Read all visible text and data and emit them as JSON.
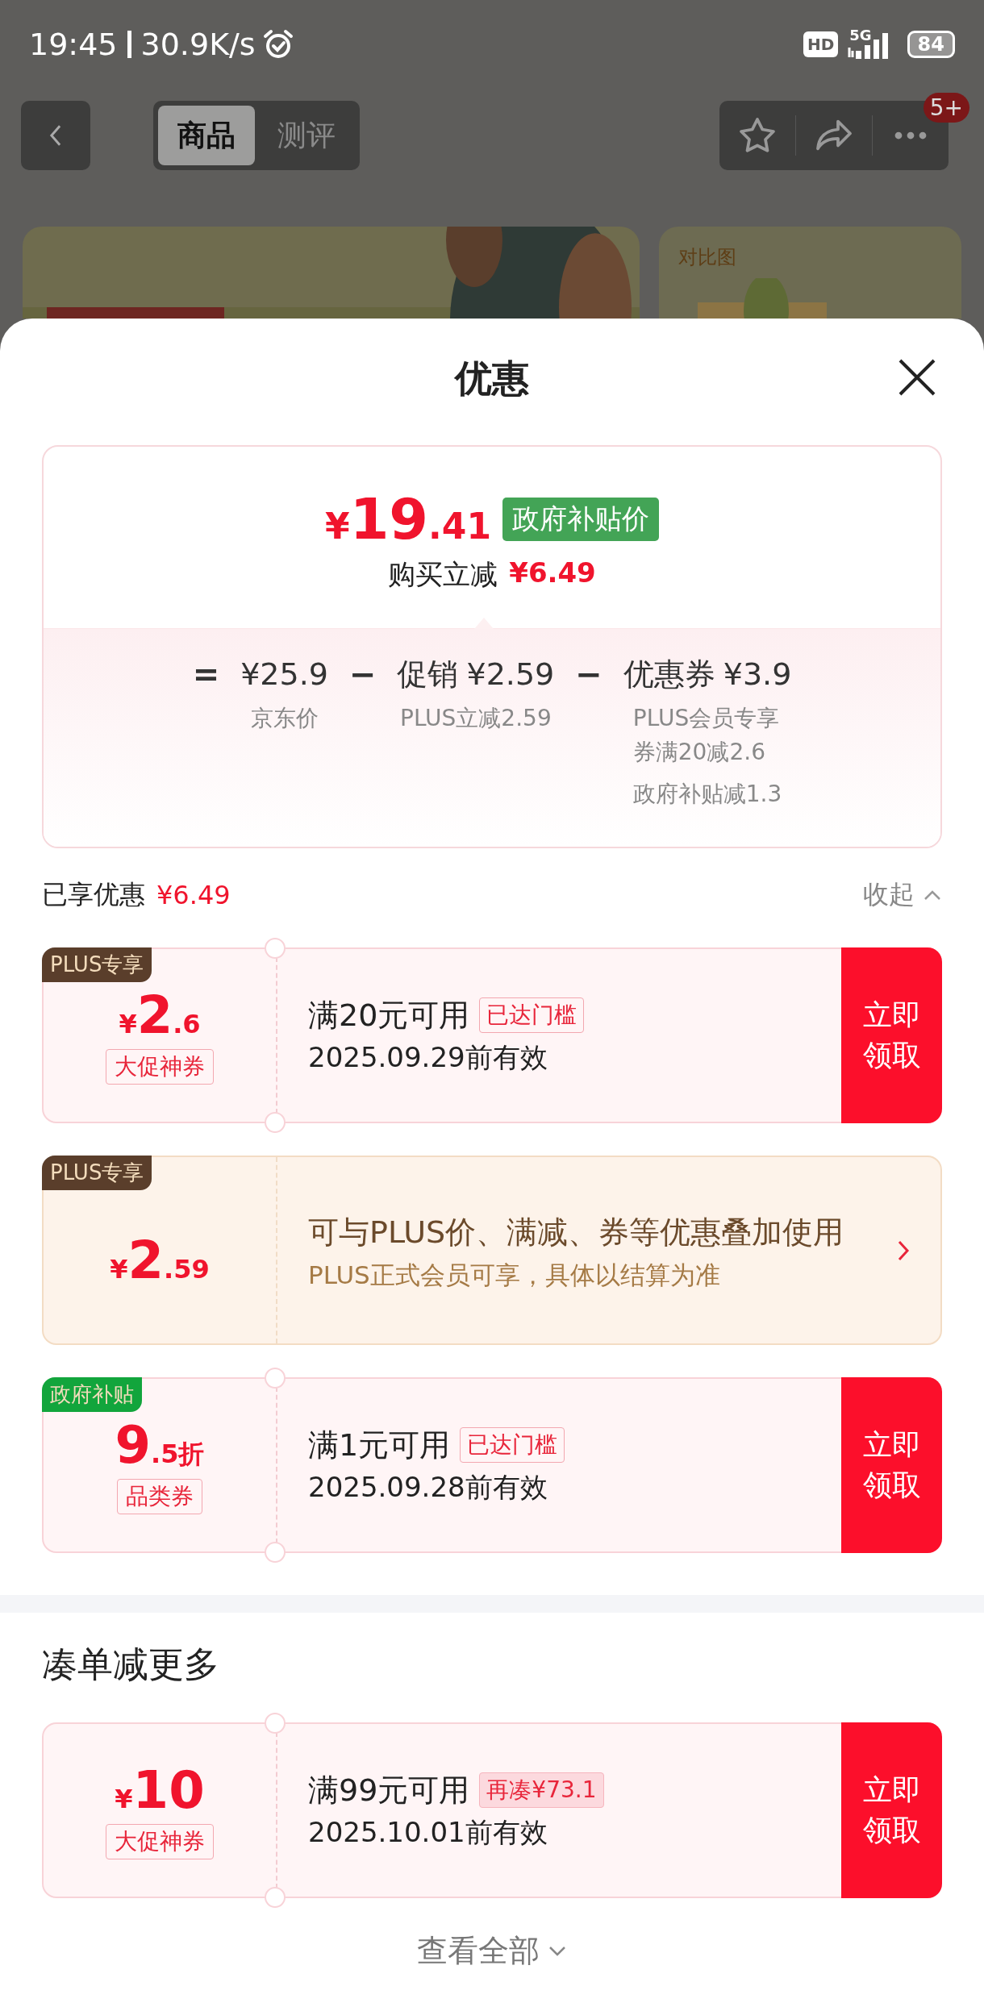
{
  "status_bar": {
    "time": "19:45",
    "speed": "30.9K/s",
    "hd": "HD",
    "network": "5G",
    "battery": "84"
  },
  "nav": {
    "tabs": [
      {
        "label": "商品",
        "selected": true
      },
      {
        "label": "测评",
        "selected": false
      }
    ],
    "badge": "5+"
  },
  "background": {
    "compare_label": "对比图"
  },
  "sheet": {
    "title": "优惠"
  },
  "summary": {
    "price": {
      "symbol": "¥",
      "integer": "19",
      "decimal": ".41"
    },
    "tag": "政府补贴价",
    "reduction_label": "购买立减",
    "reduction": "¥6.49",
    "breakdown": [
      {
        "operator": "=",
        "amount": "¥25.9",
        "notes": [
          "京东价"
        ]
      },
      {
        "operator": "−",
        "label": "促销",
        "amount": "¥2.59",
        "notes": [
          "PLUS立减2.59"
        ]
      },
      {
        "operator": "−",
        "label": "优惠券",
        "amount": "¥3.9",
        "notes": [
          "PLUS会员专享",
          "券满20减2.6",
          "政府补贴减1.3"
        ]
      }
    ]
  },
  "enjoyed": {
    "label": "已享优惠",
    "amount": "¥6.49",
    "toggle": "收起",
    "expanded": true
  },
  "coupons": [
    {
      "kind": "claim",
      "ribbon": {
        "text": "PLUS专享",
        "color": "#5a3e2b"
      },
      "value": {
        "symbol": "¥",
        "integer": "2",
        "decimal": ".6"
      },
      "tag": "大促神券",
      "condition": "满20元可用",
      "status": {
        "kind": "reached",
        "text": "已达门槛"
      },
      "expiry": "2025.09.29前有效",
      "button": "立即领取"
    },
    {
      "kind": "info",
      "ribbon": {
        "text": "PLUS专享",
        "color": "#5a3e2b"
      },
      "value": {
        "symbol": "¥",
        "integer": "2",
        "decimal": ".59"
      },
      "description": "可与PLUS价、满减、券等优惠叠加使用",
      "note": "PLUS正式会员可享，具体以结算为准"
    },
    {
      "kind": "claim",
      "ribbon": {
        "text": "政府补贴",
        "color": "#12a53c"
      },
      "value": {
        "integer": "9",
        "decimal": ".5",
        "unit": "折"
      },
      "tag": "品类券",
      "condition": "满1元可用",
      "status": {
        "kind": "reached",
        "text": "已达门槛"
      },
      "expiry": "2025.09.28前有效",
      "button": "立即领取"
    }
  ],
  "more": {
    "title": "凑单减更多",
    "coupons": [
      {
        "kind": "claim",
        "value": {
          "symbol": "¥",
          "integer": "10"
        },
        "tag": "大促神券",
        "condition": "满99元可用",
        "status": {
          "kind": "short",
          "text": "再凑¥73.1"
        },
        "expiry": "2025.10.01前有效",
        "button": "立即领取"
      }
    ],
    "view_all": "查看全部"
  }
}
